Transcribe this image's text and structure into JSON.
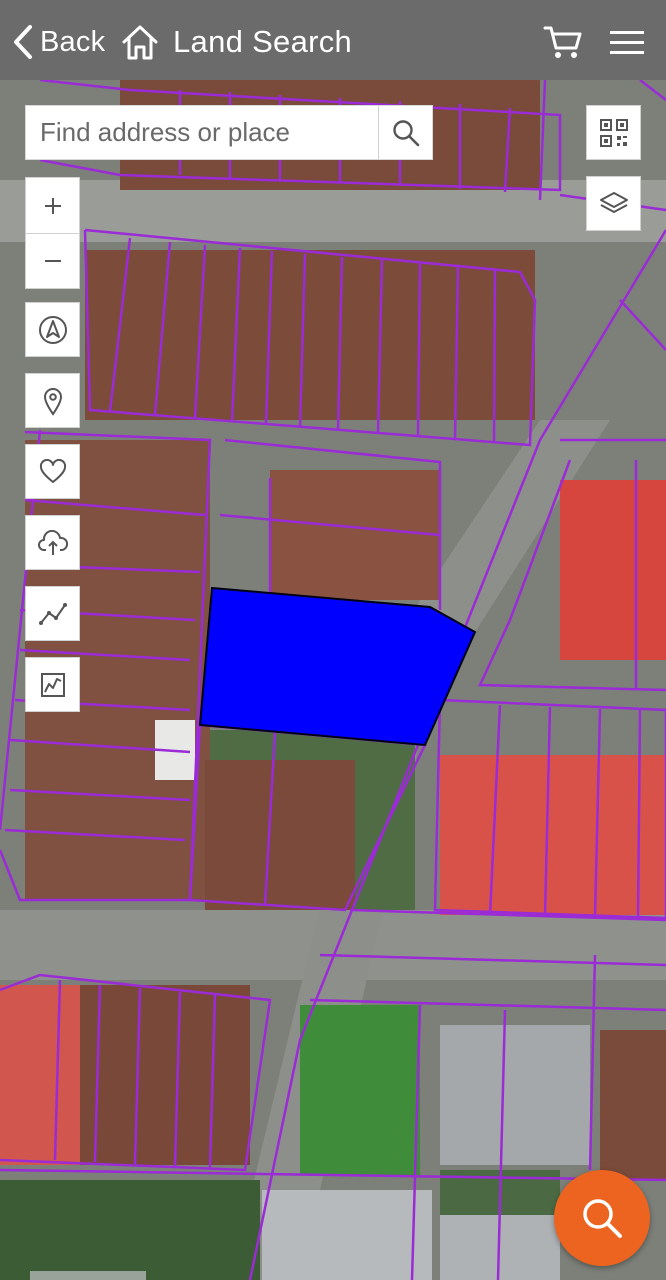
{
  "header": {
    "back_label": "Back",
    "title": "Land Search",
    "icons": [
      "chevron-left-icon",
      "home-icon",
      "cart-icon",
      "menu-icon"
    ]
  },
  "search": {
    "placeholder": "Find address or place",
    "value": "",
    "button_icon": "search-icon"
  },
  "left_tools": [
    {
      "name": "zoom-in",
      "icon": "plus-icon"
    },
    {
      "name": "zoom-out",
      "icon": "minus-icon"
    },
    {
      "name": "compass",
      "icon": "navigation-icon"
    },
    {
      "name": "location",
      "icon": "location-pin-icon"
    },
    {
      "name": "favorites",
      "icon": "heart-icon"
    },
    {
      "name": "upload",
      "icon": "cloud-upload-icon"
    },
    {
      "name": "measure",
      "icon": "polyline-icon"
    },
    {
      "name": "draw-area",
      "icon": "area-icon"
    }
  ],
  "right_tools": [
    {
      "name": "qr-code",
      "icon": "qr-code-icon"
    },
    {
      "name": "layers",
      "icon": "layers-icon"
    }
  ],
  "fab": {
    "icon": "search-icon"
  },
  "colors": {
    "topbar": "#6b6b6b",
    "parcel_line": "#9b2bd6",
    "selected_parcel": "#0000ff",
    "fab": "#ec6420"
  }
}
